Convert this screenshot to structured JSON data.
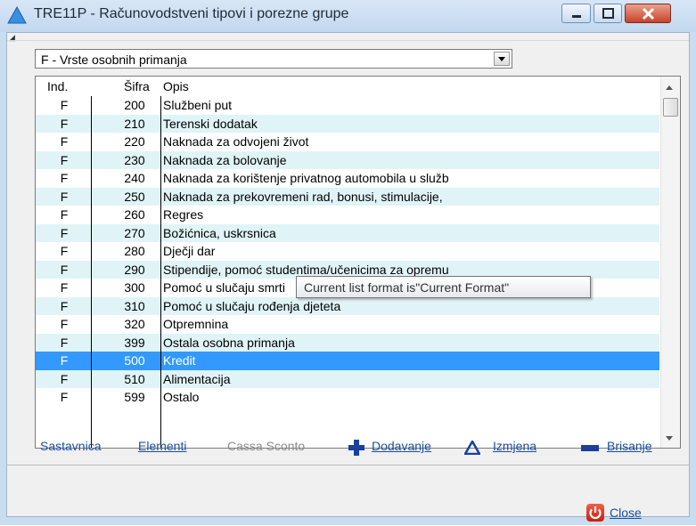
{
  "window": {
    "title": "TRE11P - Računovodstveni tipovi i porezne grupe"
  },
  "filter": {
    "selected": "F - Vrste osobnih primanja"
  },
  "list": {
    "columns": [
      "Ind.",
      "Šifra",
      "Opis"
    ],
    "rows": [
      {
        "ind": "F",
        "sifra": "200",
        "opis": "Službeni put"
      },
      {
        "ind": "F",
        "sifra": "210",
        "opis": "Terenski dodatak"
      },
      {
        "ind": "F",
        "sifra": "220",
        "opis": "Naknada za odvojeni život"
      },
      {
        "ind": "F",
        "sifra": "230",
        "opis": "Naknada za bolovanje"
      },
      {
        "ind": "F",
        "sifra": "240",
        "opis": "Naknada za korištenje privatnog automobila u služb"
      },
      {
        "ind": "F",
        "sifra": "250",
        "opis": "Naknada za prekovremeni rad, bonusi, stimulacije,"
      },
      {
        "ind": "F",
        "sifra": "260",
        "opis": "Regres"
      },
      {
        "ind": "F",
        "sifra": "270",
        "opis": "Božićnica, uskrsnica"
      },
      {
        "ind": "F",
        "sifra": "280",
        "opis": "Dječji dar"
      },
      {
        "ind": "F",
        "sifra": "290",
        "opis": "Stipendije, pomoć studentima/učenicima za opremu"
      },
      {
        "ind": "F",
        "sifra": "300",
        "opis": "Pomoć u slučaju smrti"
      },
      {
        "ind": "F",
        "sifra": "310",
        "opis": "Pomoć u slučaju rođenja djeteta"
      },
      {
        "ind": "F",
        "sifra": "320",
        "opis": "Otpremnina"
      },
      {
        "ind": "F",
        "sifra": "399",
        "opis": "Ostala osobna primanja"
      },
      {
        "ind": "F",
        "sifra": "500",
        "opis": "Kredit"
      },
      {
        "ind": "F",
        "sifra": "510",
        "opis": "Alimentacija"
      },
      {
        "ind": "F",
        "sifra": "599",
        "opis": "Ostalo"
      }
    ],
    "selected_index": 14
  },
  "tooltip": {
    "text": "Current list format is\"Current Format\""
  },
  "toolbar": {
    "sastavnica": "Sastavnica",
    "elementi": "Elementi",
    "cassa_sconto": "Cassa Sconto",
    "dodavanje": "Dodavanje",
    "izmjena": "Izmjena",
    "brisanje": "Brisanje"
  },
  "footer": {
    "close": "Close"
  },
  "colors": {
    "selection": "#3399ff",
    "alt_row": "#e0f4f7",
    "link": "#1a4fa3",
    "accent_blue": "#1a3f9e"
  },
  "icons": {
    "app": "triangle-icon",
    "add": "plus-icon",
    "edit": "triangle-icon",
    "delete": "minus-icon",
    "close": "power-icon"
  }
}
